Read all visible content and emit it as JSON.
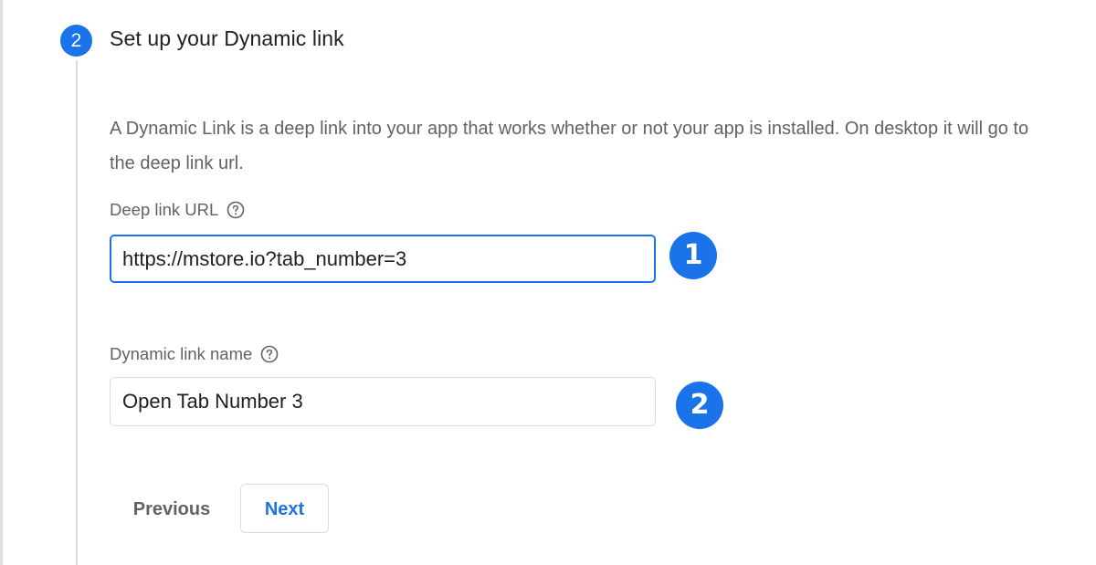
{
  "step": {
    "number": "2",
    "title": "Set up your Dynamic link",
    "description": "A Dynamic Link is a deep link into your app that works whether or not your app is installed. On desktop it will go to the deep link url."
  },
  "deep_link": {
    "label": "Deep link URL",
    "value": "https://mstore.io?tab_number=3",
    "help_icon": "help-circle-icon"
  },
  "link_name": {
    "label": "Dynamic link name",
    "value": "Open Tab Number 3",
    "help_icon": "help-circle-icon"
  },
  "annotations": {
    "badge_1": "1",
    "badge_2": "2"
  },
  "buttons": {
    "previous": "Previous",
    "next": "Next"
  },
  "colors": {
    "accent": "#1a73e8",
    "text_primary": "#202124",
    "text_secondary": "#5f6368",
    "border": "#dadce0"
  }
}
